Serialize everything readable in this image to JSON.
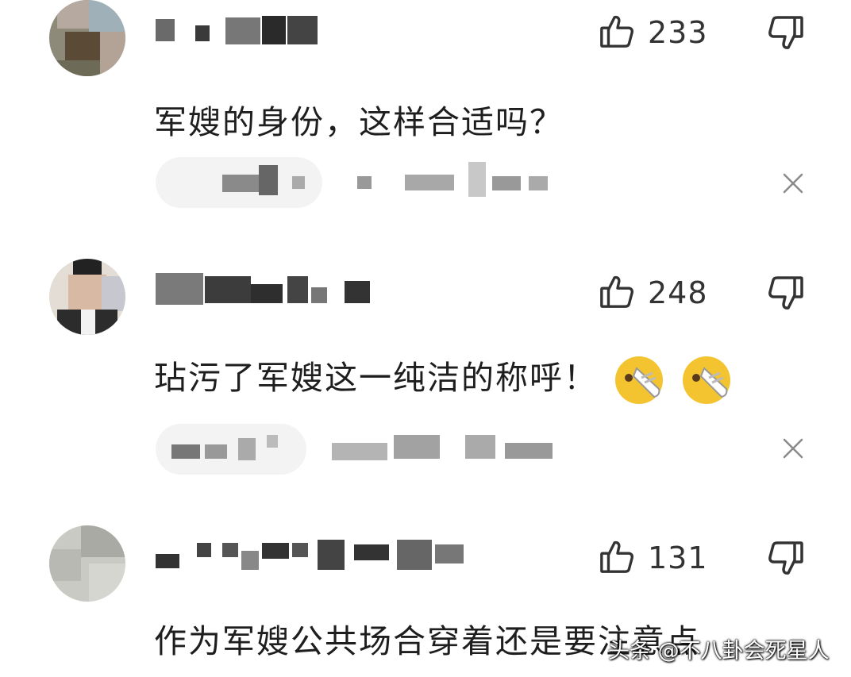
{
  "comments": [
    {
      "likes": "233",
      "text": "军嫂的身份，这样合适吗？"
    },
    {
      "likes": "248",
      "text": "玷污了军嫂这一纯洁的称呼！"
    },
    {
      "likes": "131",
      "text": "作为军嫂公共场合穿着还是要注意点"
    }
  ],
  "icons": {
    "like": "thumbs-up-icon",
    "dislike": "thumbs-down-icon",
    "close": "close-icon",
    "emoji": "slipper-face-emoji"
  },
  "watermark": "头条 @不八卦会死星人"
}
